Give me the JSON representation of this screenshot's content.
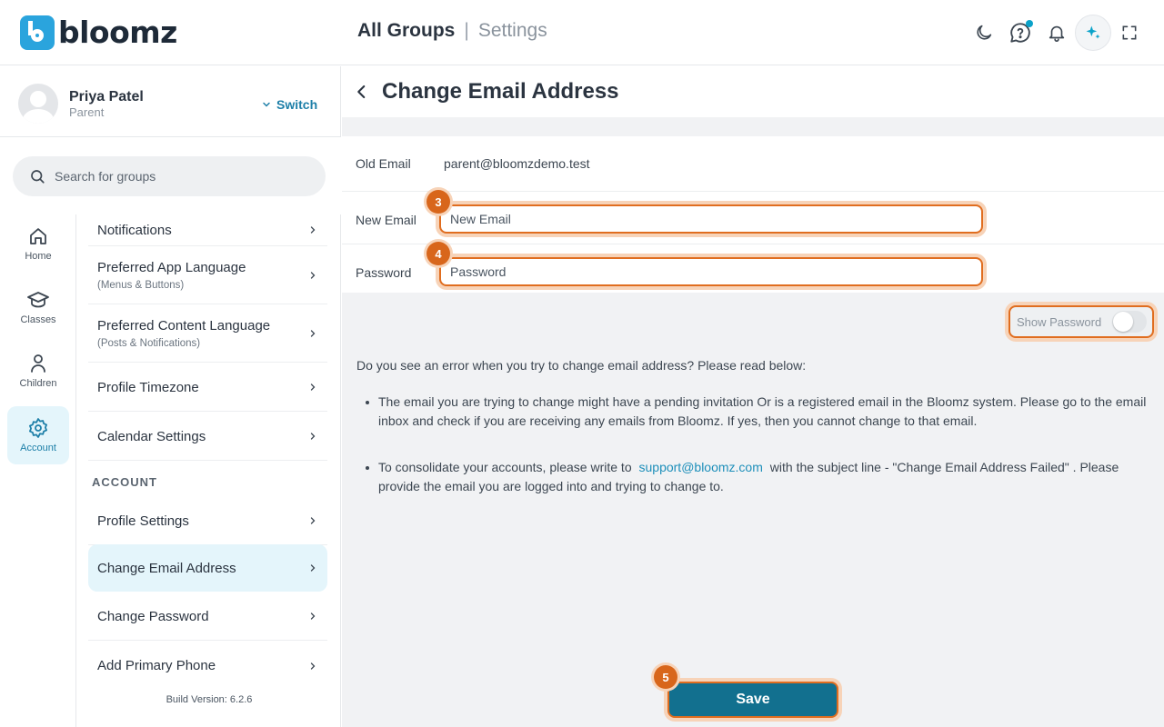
{
  "header": {
    "logo_text": "bloomz",
    "breadcrumb_primary": "All Groups",
    "breadcrumb_separator": "|",
    "breadcrumb_secondary": "Settings",
    "icons": [
      "moon-icon",
      "help-chat-icon",
      "bell-icon",
      "sparkle-icon",
      "fullscreen-icon"
    ]
  },
  "profile": {
    "name": "Priya Patel",
    "role": "Parent",
    "switch_label": "Switch"
  },
  "search": {
    "placeholder": "Search for groups"
  },
  "leftnav": {
    "items": [
      {
        "label": "Home",
        "icon": "home-icon"
      },
      {
        "label": "Classes",
        "icon": "graduation-cap-icon"
      },
      {
        "label": "Children",
        "icon": "person-icon"
      },
      {
        "label": "Account",
        "icon": "gear-icon",
        "active": true
      }
    ]
  },
  "settings": {
    "items": [
      {
        "label": "Notifications",
        "sub": ""
      },
      {
        "label": "Preferred App Language",
        "sub": "(Menus & Buttons)"
      },
      {
        "label": "Preferred Content Language",
        "sub": "(Posts & Notifications)"
      },
      {
        "label": "Profile Timezone",
        "sub": ""
      },
      {
        "label": "Calendar Settings",
        "sub": ""
      }
    ],
    "section_account": "ACCOUNT",
    "account_items": [
      {
        "label": "Profile Settings"
      },
      {
        "label": "Change Email Address",
        "active": true
      },
      {
        "label": "Change Password"
      },
      {
        "label": "Add Primary Phone"
      }
    ],
    "build_version": "Build Version: 6.2.6"
  },
  "main": {
    "title": "Change Email Address",
    "old_email_label": "Old Email",
    "old_email_value": "parent@bloomzdemo.test",
    "new_email_label": "New Email",
    "new_email_placeholder": "New Email",
    "password_label": "Password",
    "password_placeholder": "Password",
    "show_password_label": "Show Password",
    "show_password_on": false,
    "help_intro": "Do you see an error when you try to change email address? Please read below:",
    "help_bullet_1": "The email you are trying to change might have a pending invitation Or is a registered email in the Bloomz system. Please go to the email inbox and  check if you are receiving any emails from Bloomz. If yes, then you cannot change to that email.",
    "help_bullet_2_pre": "To consolidate your accounts, please write to",
    "help_bullet_2_link": "support@bloomz.com",
    "help_bullet_2_post": "with the subject line - \"Change Email Address Failed\" . Please provide the email you are logged into and trying to change to.",
    "save_label": "Save"
  },
  "annotations": {
    "step_new_email": "3",
    "step_password": "4",
    "step_save": "5",
    "accent_color": "#e06d1f"
  }
}
